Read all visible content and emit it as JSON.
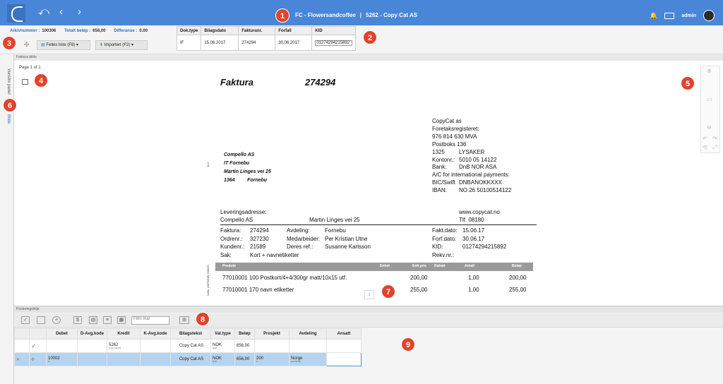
{
  "topbar": {
    "title_left": "FC - Flowersandcoffee",
    "separator": "|",
    "title_right": "5262 - Copy Cat AS",
    "user": "admin"
  },
  "header": {
    "bilag_label": "Arkivnummer :",
    "bilag_value": "100306",
    "total_label": "Totalt beløp :",
    "total_value": "656,00",
    "diff_label": "Differanse :",
    "diff_value": "0.00",
    "btn_felles": "Felles liste (F8)",
    "btn_importert": "Importert (F2)"
  },
  "doc_table": {
    "headers": [
      "Dok.type",
      "Bilagsdato",
      "Fakturanr.",
      "Forfall",
      "KID"
    ],
    "row": [
      "IF",
      "15.06.2017",
      "274294",
      "30.06.2017",
      "01274294215892"
    ]
  },
  "panel": {
    "section_label": "Faktura bilde",
    "page_info": "Page 1 of 1",
    "side_tab_1": "Venstre panel",
    "side_tab_2": "Bilde",
    "pager": "1"
  },
  "invoice": {
    "heading": "Faktura",
    "number": "274294",
    "customer": [
      "Compello AS",
      "IT Fornebu",
      "Martin Linges vei 25",
      "1364         Fornebu"
    ],
    "seller_top": [
      "CopyCat as",
      "Foretaksregisteret:",
      "976 814 630 MVA",
      "Postboks 136"
    ],
    "seller_rows": [
      {
        "k": "1325",
        "v": "LYSAKER"
      },
      {
        "k": "Kontonr.:",
        "v": "5010 05 14122"
      },
      {
        "k": "Bank:",
        "v": "DnB NOR ASA"
      }
    ],
    "intl_label": "A/C for international payments:",
    "intl_rows": [
      {
        "k": "BIC/Swift",
        "v": "DNBANOKKXXX"
      },
      {
        "k": "IBAN:",
        "v": "NO 26 50100514122"
      }
    ],
    "lev_label": "Leveringsadresse:",
    "lev_name": "Compello AS",
    "lev_street": "Martin Linges vei 25",
    "web": "www.copycat.no",
    "tlf": "Tlf. 08180",
    "fields": {
      "faktura_k": "Faktura:",
      "faktura_v": "274294",
      "ordrenr_k": "Ordrenr.:",
      "ordrenr_v": "327230",
      "kundenr_k": "Kundenr.:",
      "kundenr_v": "21589",
      "sak_k": "Sak:",
      "sak_v": "Kort + navnetiketter",
      "avdeling_k": "Avdeling:",
      "avdeling_v": "Fornebu",
      "medarb_k": "Medarbeider:",
      "medarb_v": "Per Kristian Utne",
      "deres_k": "Deres ref.:",
      "deres_v": "Susanne Karlsson",
      "fakt_k": "Fakt.dato:",
      "fakt_v": "15.06.17",
      "forf_k": "Forf.dato:",
      "forf_v": "30.06.17",
      "kid_k": "KID:",
      "kid_v": "01274294215892",
      "rekv_k": "Rekv.nr.:"
    },
    "prod_headers": {
      "produkt": "Produkt",
      "enhet": "Enhet",
      "enhpris": "Enh.pris",
      "rabatt": "Rabatt",
      "antall": "Antall",
      "belop": "Beløp"
    },
    "lines": [
      {
        "desc": "77010001 100 Postkort/4+4/300gr matt/10x15 utf.",
        "pris": "200,00",
        "antall": "1,00",
        "belop": "200,00"
      },
      {
        "desc": "77010001 170 navn etiketter",
        "pris": "255,00",
        "antall": "1,00",
        "belop": "255,00"
      }
    ],
    "vert_small": "11.3",
    "vert_code": "Vaflu. (0070009) 200010"
  },
  "posting": {
    "section_label": "Posteringslinje",
    "search_placeholder": "Finn mal",
    "headers": [
      "",
      "Debet",
      "D-Avg.kode",
      "Kredit",
      "K-Avg.kode",
      "Bilagstekst",
      "Val.type",
      "Beløp",
      "Prosjekt",
      "Avdeling",
      "Ansatt"
    ],
    "row1": {
      "kredit": "5262",
      "kredit_sub": "Copy Cat AS",
      "tekst": "Copy Cat AS",
      "val": "NOK",
      "val_sub": "NOK",
      "belop": "656,00"
    },
    "row2": {
      "debet": "10002",
      "debet_sub": "IT",
      "tekst": "Copy Cat AS",
      "val": "NOK",
      "val_sub": "NOK",
      "belop": "656,00",
      "prosjekt": "200",
      "prosjekt_sub": "IT",
      "avdeling": "Norge",
      "avdeling_sub": "Avd Norge"
    }
  },
  "markers": [
    "1",
    "2",
    "3",
    "4",
    "5",
    "6",
    "7",
    "8",
    "9"
  ],
  "colors": {
    "topbar": "#4a86d8",
    "marker": "#e0442b",
    "selected_row": "#b6d3ef"
  }
}
